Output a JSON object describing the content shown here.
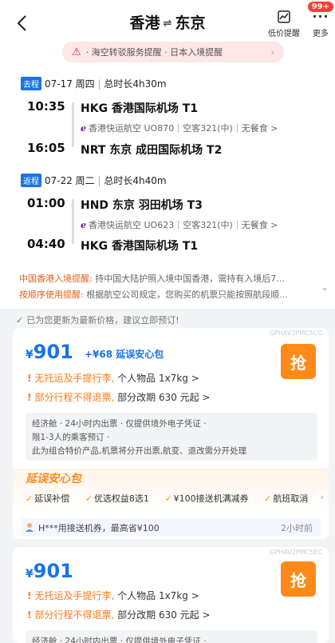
{
  "header": {
    "origin": "香港",
    "dest": "东京",
    "price_alert_label": "低价提醒",
    "more_label": "更多",
    "badge": "99+"
  },
  "notice": {
    "text": "· 海空转驳服务提醒 · 日本入境提醒"
  },
  "outbound": {
    "tag": "去程",
    "date": "07-17 周四",
    "duration": "总时长4h30m",
    "dep_time": "10:35",
    "dep_airport": "HKG  香港国际机场 T1",
    "flight": "香港快运航空 UO870｜空客321(中)｜无餐食 >",
    "arr_time": "16:05",
    "arr_airport": "NRT  东京 成田国际机场 T2"
  },
  "inbound": {
    "tag": "返程",
    "date": "07-22 周二",
    "duration": "总时长4h40m",
    "dep_time": "01:00",
    "dep_airport": "HND  东京 羽田机场 T3",
    "flight": "香港快运航空 UO623｜空客321(中)｜无餐食 >",
    "arr_time": "04:40",
    "arr_airport": "HKG  香港国际机场 T1"
  },
  "reminders": {
    "r1_label": "中国香港入境提醒:",
    "r1_text": " 持中国大陆护照入境中国香港，需持有入境后7...",
    "r2_label": "按顺序使用提醒:",
    "r2_text": " 根据航空公司规定，您购买的机票只能按照航段顺..."
  },
  "updated": "已为您更新为最新价格，建议立即预订!",
  "cards": [
    {
      "code": "GPHAV2PMC5CC",
      "currency": "¥",
      "price": "901",
      "addon": "+¥68 延误安心包",
      "grab": "抢",
      "rule1_o": "无托运及手提行李,",
      "rule1_t": " 个人物品 1x7kg >",
      "rule2_o": "部分行程不得退票,",
      "rule2_t": " 部分改期 630 元起 >",
      "detail1": "经济舱 · 24小时内出票 · 仅提供境外电子凭证 ·",
      "detail2": "限1-3人的乘客预订 ·",
      "detail3": "此为组合特价产品,机票将分开出票,航变、退改需分开处理",
      "insure_title": "延误安心包",
      "insure_items": [
        "延误补偿",
        "优选权益8选1",
        "¥100接送机满减券",
        "航班取消"
      ],
      "social_text": "H***用接送机券，最高省¥100",
      "social_time": "2小时前"
    },
    {
      "code": "GPHAV2PMC5EC",
      "currency": "¥",
      "price": "901",
      "grab": "抢",
      "rule1_o": "无托运及手提行李,",
      "rule1_t": " 个人物品 1x7kg >",
      "rule2_o": "部分行程不得退票,",
      "rule2_t": " 部分改期 630 元起 >",
      "detail1": "经济舱 · 24小时内出票 · 仅提供境外电子凭证 ·"
    }
  ]
}
